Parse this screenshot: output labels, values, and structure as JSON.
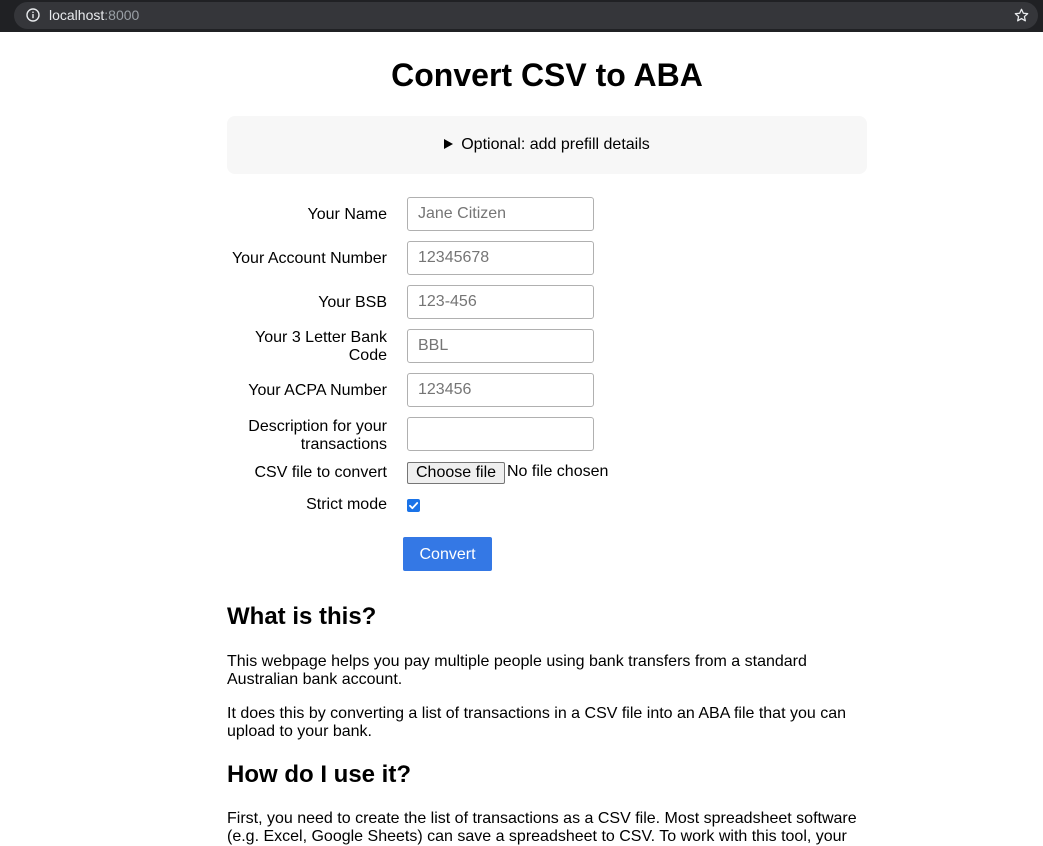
{
  "browser": {
    "url_host": "localhost",
    "url_port": ":8000"
  },
  "page": {
    "title": "Convert CSV to ABA",
    "details_summary": "Optional: add prefill details"
  },
  "form": {
    "name_label": "Your Name",
    "name_placeholder": "Jane Citizen",
    "account_label": "Your Account Number",
    "account_placeholder": "12345678",
    "bsb_label": "Your BSB",
    "bsb_placeholder": "123-456",
    "bank_code_label": "Your 3 Letter Bank Code",
    "bank_code_placeholder": "BBL",
    "acpa_label": "Your ACPA Number",
    "acpa_placeholder": "123456",
    "description_label": "Description for your transactions",
    "description_value": "",
    "csv_label": "CSV file to convert",
    "file_button": "Choose file",
    "file_status": "No file chosen",
    "strict_label": "Strict mode",
    "strict_checked": true,
    "convert_label": "Convert"
  },
  "info": {
    "what_heading": "What is this?",
    "what_p1": "This webpage helps you pay multiple people using bank transfers from a standard Australian bank account.",
    "what_p2": "It does this by converting a list of transactions in a CSV file into an ABA file that you can upload to your bank.",
    "how_heading": "How do I use it?",
    "how_p1": "First, you need to create the list of transactions as a CSV file. Most spreadsheet software (e.g. Excel, Google Sheets) can save a spreadsheet to CSV. To work with this tool, your"
  },
  "colors": {
    "accent": "#3478e5",
    "checkbox": "#1a73e8",
    "browser_bar": "#202124"
  }
}
